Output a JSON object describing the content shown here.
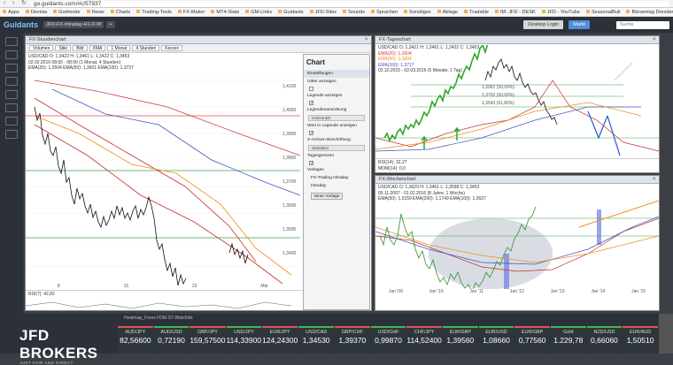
{
  "browser": {
    "url": "go.guidants.com/#c/57937"
  },
  "bookmarks": [
    "Apps",
    "Devisia",
    "Godmode",
    "News",
    "Charts",
    "Trading-Tools",
    "FX-Maker",
    "MT4-Stats",
    "GM-Links",
    "Guidants",
    "JFD-Sites",
    "Sounds",
    "Sprachen",
    "Sonstiges",
    "Ablage",
    "Tradable",
    "IM: JFD - DESK",
    "JFD - YouTube",
    "SeasonalBull",
    "Börsentag Dresden"
  ],
  "app": {
    "logo": "Guidants",
    "menu": [
      "JFD-FX-Intraday-H1-D-W",
      "+"
    ],
    "login": "Desktop Login",
    "markt": "Markt",
    "search": "Suche"
  },
  "left_chart": {
    "title": "FX-Stundenchart",
    "toolbar": [
      "Volumen",
      "Stile",
      "Bild",
      "XMA",
      "1 Monat",
      "4 Stunden",
      "Kerzen"
    ],
    "legend1": "USD/CAD O: 1,3422 H: 1,3461 L: 1,3422 C: 1,3453",
    "legend2": "02.02.2016 08:00 - 08:00 (1 Monat, 4 Stunden)",
    "legend3": "EMA(20): 1,3504   EMA(50): 1,3601   EMA(100): 1,3737",
    "yticks": [
      "1,4100",
      "1,4000",
      "1,3900",
      "1,3800",
      "1,3700",
      "1,3600",
      "1,3500",
      "1,3400"
    ],
    "xticks": [
      "8",
      "15",
      "22",
      "Mär"
    ],
    "rsi": "RSI(7): 42,82"
  },
  "settings": {
    "title": "Chart",
    "heading": "Einstellungen",
    "items": [
      "Gitter anzeigen",
      "Legende anzeigen",
      "Legendenanordnung",
      "Wert in Legende anzeigen",
      "X-Achsen Beschriftung",
      "Tagesgrenzen",
      "Vorlagen"
    ],
    "legend_pos": "Horizontal",
    "x_axis": "Standard",
    "templates": [
      "FX-Trading Intraday",
      "Intraday"
    ],
    "new_template": "Neue Vorlage"
  },
  "top_right": {
    "title": "FX-Tageschart",
    "legend1": "USD/CAD O: 1,3421 H: 1,3461 L: 1,3422 C: 1,3453",
    "legend2": "EMA(20): 1,3604",
    "legend3": "EMA(50): 1,3604",
    "legend4": "EMA(100): 1,3717",
    "legend5": "02.10.2015 - 02.03.2016 (5 Monate, 1 Tag)",
    "fibs": [
      "1,3062 (50,00%)",
      "1,3752 (50,00%)",
      "1,3543 (61,80%)"
    ],
    "rsi": "RSI(14): 32,27",
    "mom": "MOM(14): 0,0"
  },
  "bottom_right": {
    "title": "FX-Wochenchart",
    "legend1": "USD/CAD O: 1,3629 H: 1,3461 L: 1,3598 C: 1,3453",
    "legend2": "05.11.2007 - 01.02.2016 (8 Jahre, 1 Woche)",
    "ema": "EMA(50): 1,3159   EMA(200): 1,1749   EMA(100): 1,2637",
    "xticks": [
      "Jan '09",
      "Jan '10",
      "Jan '11",
      "Jan '12",
      "Jan '13",
      "Jan '14",
      "Jan '15"
    ]
  },
  "watchlist": {
    "title": "Heatmap_Forex FDM-ST-Watchlist",
    "brand": "JFD BROKERS",
    "tagline": "JUST FAIR AND DIRECT",
    "items": [
      {
        "name": "AUD/JPY",
        "value": "82,56600",
        "dir": "dn"
      },
      {
        "name": "AUD/USD",
        "value": "0,72190",
        "dir": "up"
      },
      {
        "name": "GBP/JPY",
        "value": "159,57500",
        "dir": "dn"
      },
      {
        "name": "USD/JPY",
        "value": "114,33900",
        "dir": "up"
      },
      {
        "name": "EUR/JPY",
        "value": "124,24300",
        "dir": "dn"
      },
      {
        "name": "USD/CAD",
        "value": "1,34530",
        "dir": "up"
      },
      {
        "name": "GBP/CHF",
        "value": "1,39370",
        "dir": "dn"
      },
      {
        "name": "USD/CHF",
        "value": "0,99870",
        "dir": "up"
      },
      {
        "name": "CHF/JPY",
        "value": "114,52400",
        "dir": "dn"
      },
      {
        "name": "EUR/GBP",
        "value": "1,39560",
        "dir": "up"
      },
      {
        "name": "EUR/USD",
        "value": "1,08660",
        "dir": "up"
      },
      {
        "name": "EUR/GBP",
        "value": "0,77560",
        "dir": "dn"
      },
      {
        "name": "Gold",
        "value": "1.229,78",
        "dir": "up"
      },
      {
        "name": "NZD/USD",
        "value": "0,66060",
        "dir": "up"
      },
      {
        "name": "EUR/AUD",
        "value": "1,50510",
        "dir": "dn"
      }
    ]
  }
}
